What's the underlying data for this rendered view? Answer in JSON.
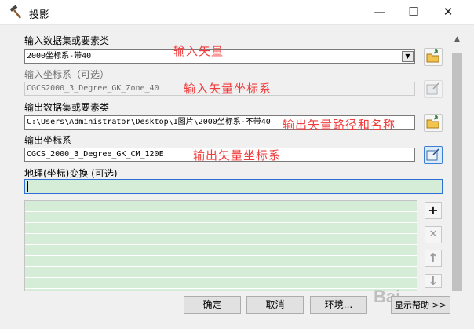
{
  "window": {
    "title": "投影"
  },
  "form": {
    "input_dataset": {
      "label": "输入数据集或要素类",
      "value": "2000坐标系-带40",
      "annotation": "输入矢量"
    },
    "input_crs": {
      "label": "输入坐标系（可选）",
      "value": "CGCS2000_3_Degree_GK_Zone_40",
      "annotation": "输入矢量坐标系"
    },
    "output_dataset": {
      "label": "输出数据集或要素类",
      "value": "C:\\Users\\Administrator\\Desktop\\1图片\\2000坐标系-不带40",
      "annotation": "输出矢量路径和名称"
    },
    "output_crs": {
      "label": "输出坐标系",
      "value": "CGCS_2000_3_Degree_GK_CM_120E",
      "annotation": "输出矢量坐标系"
    },
    "geo_transform": {
      "label": "地理(坐标)变换 (可选)",
      "value": ""
    }
  },
  "side_buttons": {
    "add": "+",
    "remove": "✕",
    "up": "↑",
    "down": "↓"
  },
  "footer": {
    "ok": "确定",
    "cancel": "取消",
    "env": "环境...",
    "help": "显示帮助 >>"
  },
  "watermark": "Bai"
}
